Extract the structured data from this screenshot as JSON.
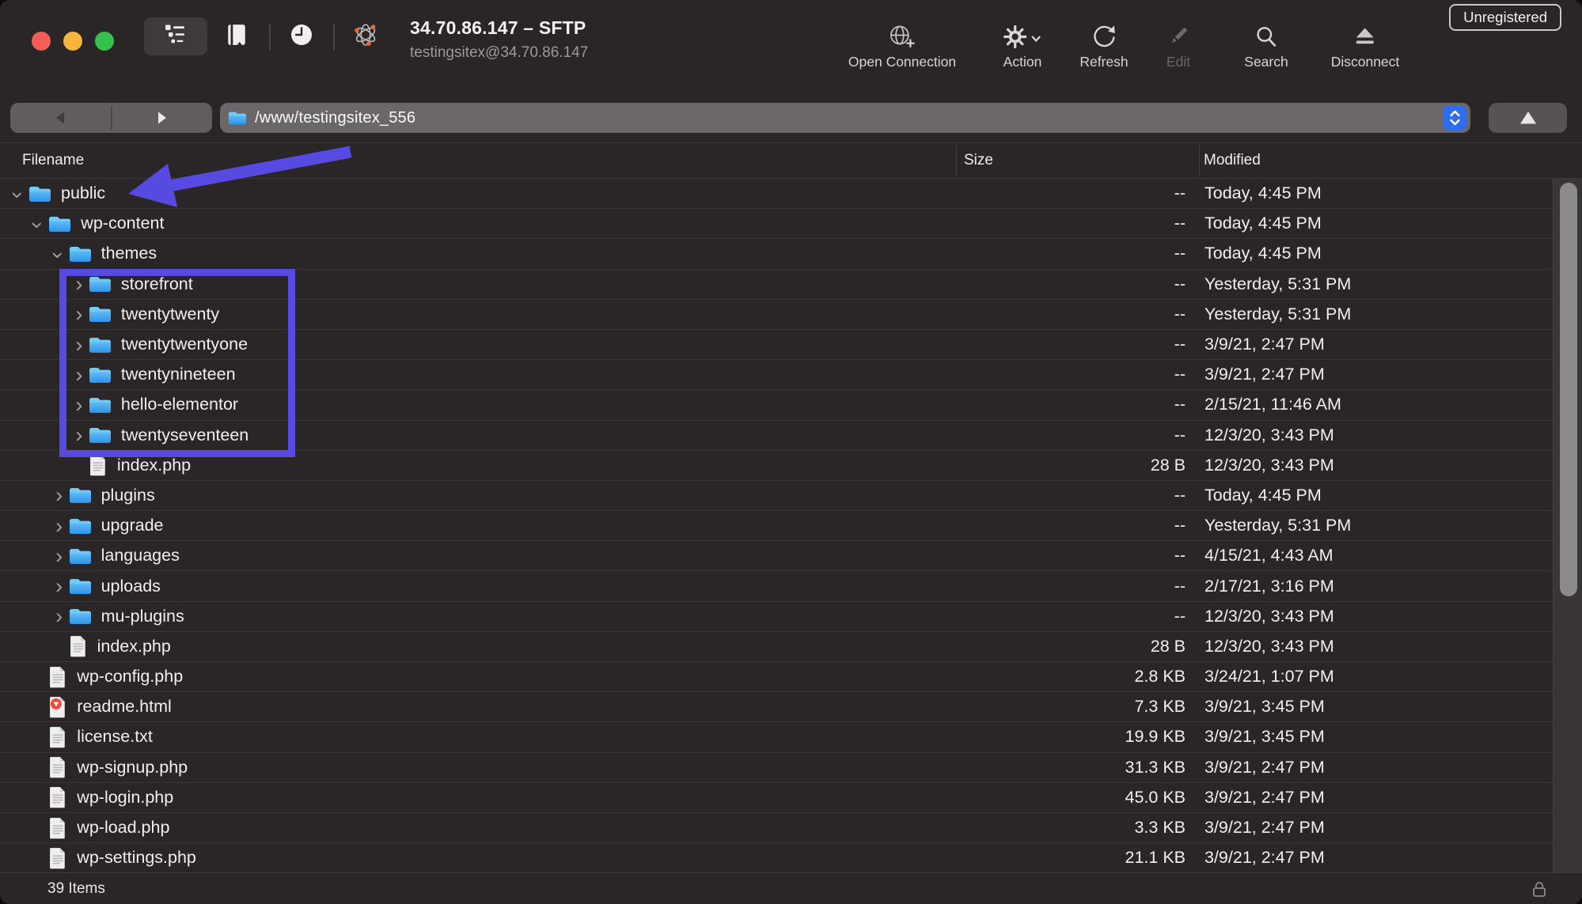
{
  "window": {
    "title": "34.70.86.147 – SFTP",
    "subtitle": "testingsitex@34.70.86.147",
    "badge": "Unregistered"
  },
  "toolbar": {
    "items": [
      {
        "label": "Open Connection",
        "icon": "globe-plus",
        "disabled": false
      },
      {
        "label": "Action",
        "icon": "gear-chevron",
        "disabled": false
      },
      {
        "label": "Refresh",
        "icon": "circular-arrow",
        "disabled": false
      },
      {
        "label": "Edit",
        "icon": "pencil",
        "disabled": true
      },
      {
        "label": "Search",
        "icon": "magnifier",
        "disabled": false
      },
      {
        "label": "Disconnect",
        "icon": "eject",
        "disabled": false
      }
    ],
    "view_icons": [
      "outline-view",
      "bookmarks-book",
      "history-clock",
      "bonjour-atom"
    ]
  },
  "pathbar": {
    "path": "/www/testingsitex_556",
    "back_icon": "triangle-left",
    "forward_icon": "triangle-right",
    "stepper_icon": "up-down-chevrons",
    "upload_icon": "triangle-up"
  },
  "columns": {
    "filename": "Filename",
    "size": "Size",
    "modified": "Modified"
  },
  "list": {
    "rows": [
      {
        "name": "public",
        "kind": "folder",
        "level": 0,
        "state": "expanded",
        "size": "--",
        "modified": "Today, 4:45 PM"
      },
      {
        "name": "wp-content",
        "kind": "folder",
        "level": 1,
        "state": "expanded",
        "size": "--",
        "modified": "Today, 4:45 PM"
      },
      {
        "name": "themes",
        "kind": "folder",
        "level": 2,
        "state": "expanded",
        "size": "--",
        "modified": "Today, 4:45 PM"
      },
      {
        "name": "storefront",
        "kind": "folder",
        "level": 3,
        "state": "collapsed",
        "size": "--",
        "modified": "Yesterday, 5:31 PM"
      },
      {
        "name": "twentytwenty",
        "kind": "folder",
        "level": 3,
        "state": "collapsed",
        "size": "--",
        "modified": "Yesterday, 5:31 PM"
      },
      {
        "name": "twentytwentyone",
        "kind": "folder",
        "level": 3,
        "state": "collapsed",
        "size": "--",
        "modified": "3/9/21, 2:47 PM"
      },
      {
        "name": "twentynineteen",
        "kind": "folder",
        "level": 3,
        "state": "collapsed",
        "size": "--",
        "modified": "3/9/21, 2:47 PM"
      },
      {
        "name": "hello-elementor",
        "kind": "folder",
        "level": 3,
        "state": "collapsed",
        "size": "--",
        "modified": "2/15/21, 11:46 AM"
      },
      {
        "name": "twentyseventeen",
        "kind": "folder",
        "level": 3,
        "state": "collapsed",
        "size": "--",
        "modified": "12/3/20, 3:43 PM"
      },
      {
        "name": "index.php",
        "kind": "file",
        "level": 3,
        "state": null,
        "size": "28 B",
        "modified": "12/3/20, 3:43 PM"
      },
      {
        "name": "plugins",
        "kind": "folder",
        "level": 2,
        "state": "collapsed",
        "size": "--",
        "modified": "Today, 4:45 PM"
      },
      {
        "name": "upgrade",
        "kind": "folder",
        "level": 2,
        "state": "collapsed",
        "size": "--",
        "modified": "Yesterday, 5:31 PM"
      },
      {
        "name": "languages",
        "kind": "folder",
        "level": 2,
        "state": "collapsed",
        "size": "--",
        "modified": "4/15/21, 4:43 AM"
      },
      {
        "name": "uploads",
        "kind": "folder",
        "level": 2,
        "state": "collapsed",
        "size": "--",
        "modified": "2/17/21, 3:16 PM"
      },
      {
        "name": "mu-plugins",
        "kind": "folder",
        "level": 2,
        "state": "collapsed",
        "size": "--",
        "modified": "12/3/20, 3:43 PM"
      },
      {
        "name": "index.php",
        "kind": "file",
        "level": 2,
        "state": null,
        "size": "28 B",
        "modified": "12/3/20, 3:43 PM"
      },
      {
        "name": "wp-config.php",
        "kind": "file",
        "level": 1,
        "state": null,
        "size": "2.8 KB",
        "modified": "3/24/21, 1:07 PM"
      },
      {
        "name": "readme.html",
        "kind": "html",
        "level": 1,
        "state": null,
        "size": "7.3 KB",
        "modified": "3/9/21, 3:45 PM"
      },
      {
        "name": "license.txt",
        "kind": "file",
        "level": 1,
        "state": null,
        "size": "19.9 KB",
        "modified": "3/9/21, 3:45 PM"
      },
      {
        "name": "wp-signup.php",
        "kind": "file",
        "level": 1,
        "state": null,
        "size": "31.3 KB",
        "modified": "3/9/21, 2:47 PM"
      },
      {
        "name": "wp-login.php",
        "kind": "file",
        "level": 1,
        "state": null,
        "size": "45.0 KB",
        "modified": "3/9/21, 2:47 PM"
      },
      {
        "name": "wp-load.php",
        "kind": "file",
        "level": 1,
        "state": null,
        "size": "3.3 KB",
        "modified": "3/9/21, 2:47 PM"
      },
      {
        "name": "wp-settings.php",
        "kind": "file",
        "level": 1,
        "state": null,
        "size": "21.1 KB",
        "modified": "3/9/21, 2:47 PM"
      }
    ]
  },
  "status": {
    "items": "39 Items",
    "lock_icon": "padlock"
  },
  "colors": {
    "annotation_blue": "#574ae0",
    "folder_blue_top": "#74cbf6",
    "folder_blue_bottom": "#2f95ec",
    "stepper_blue": "#2f6cf0",
    "traffic_red": "#f35f56",
    "traffic_yellow": "#f6b53c",
    "traffic_green": "#36c04c"
  }
}
